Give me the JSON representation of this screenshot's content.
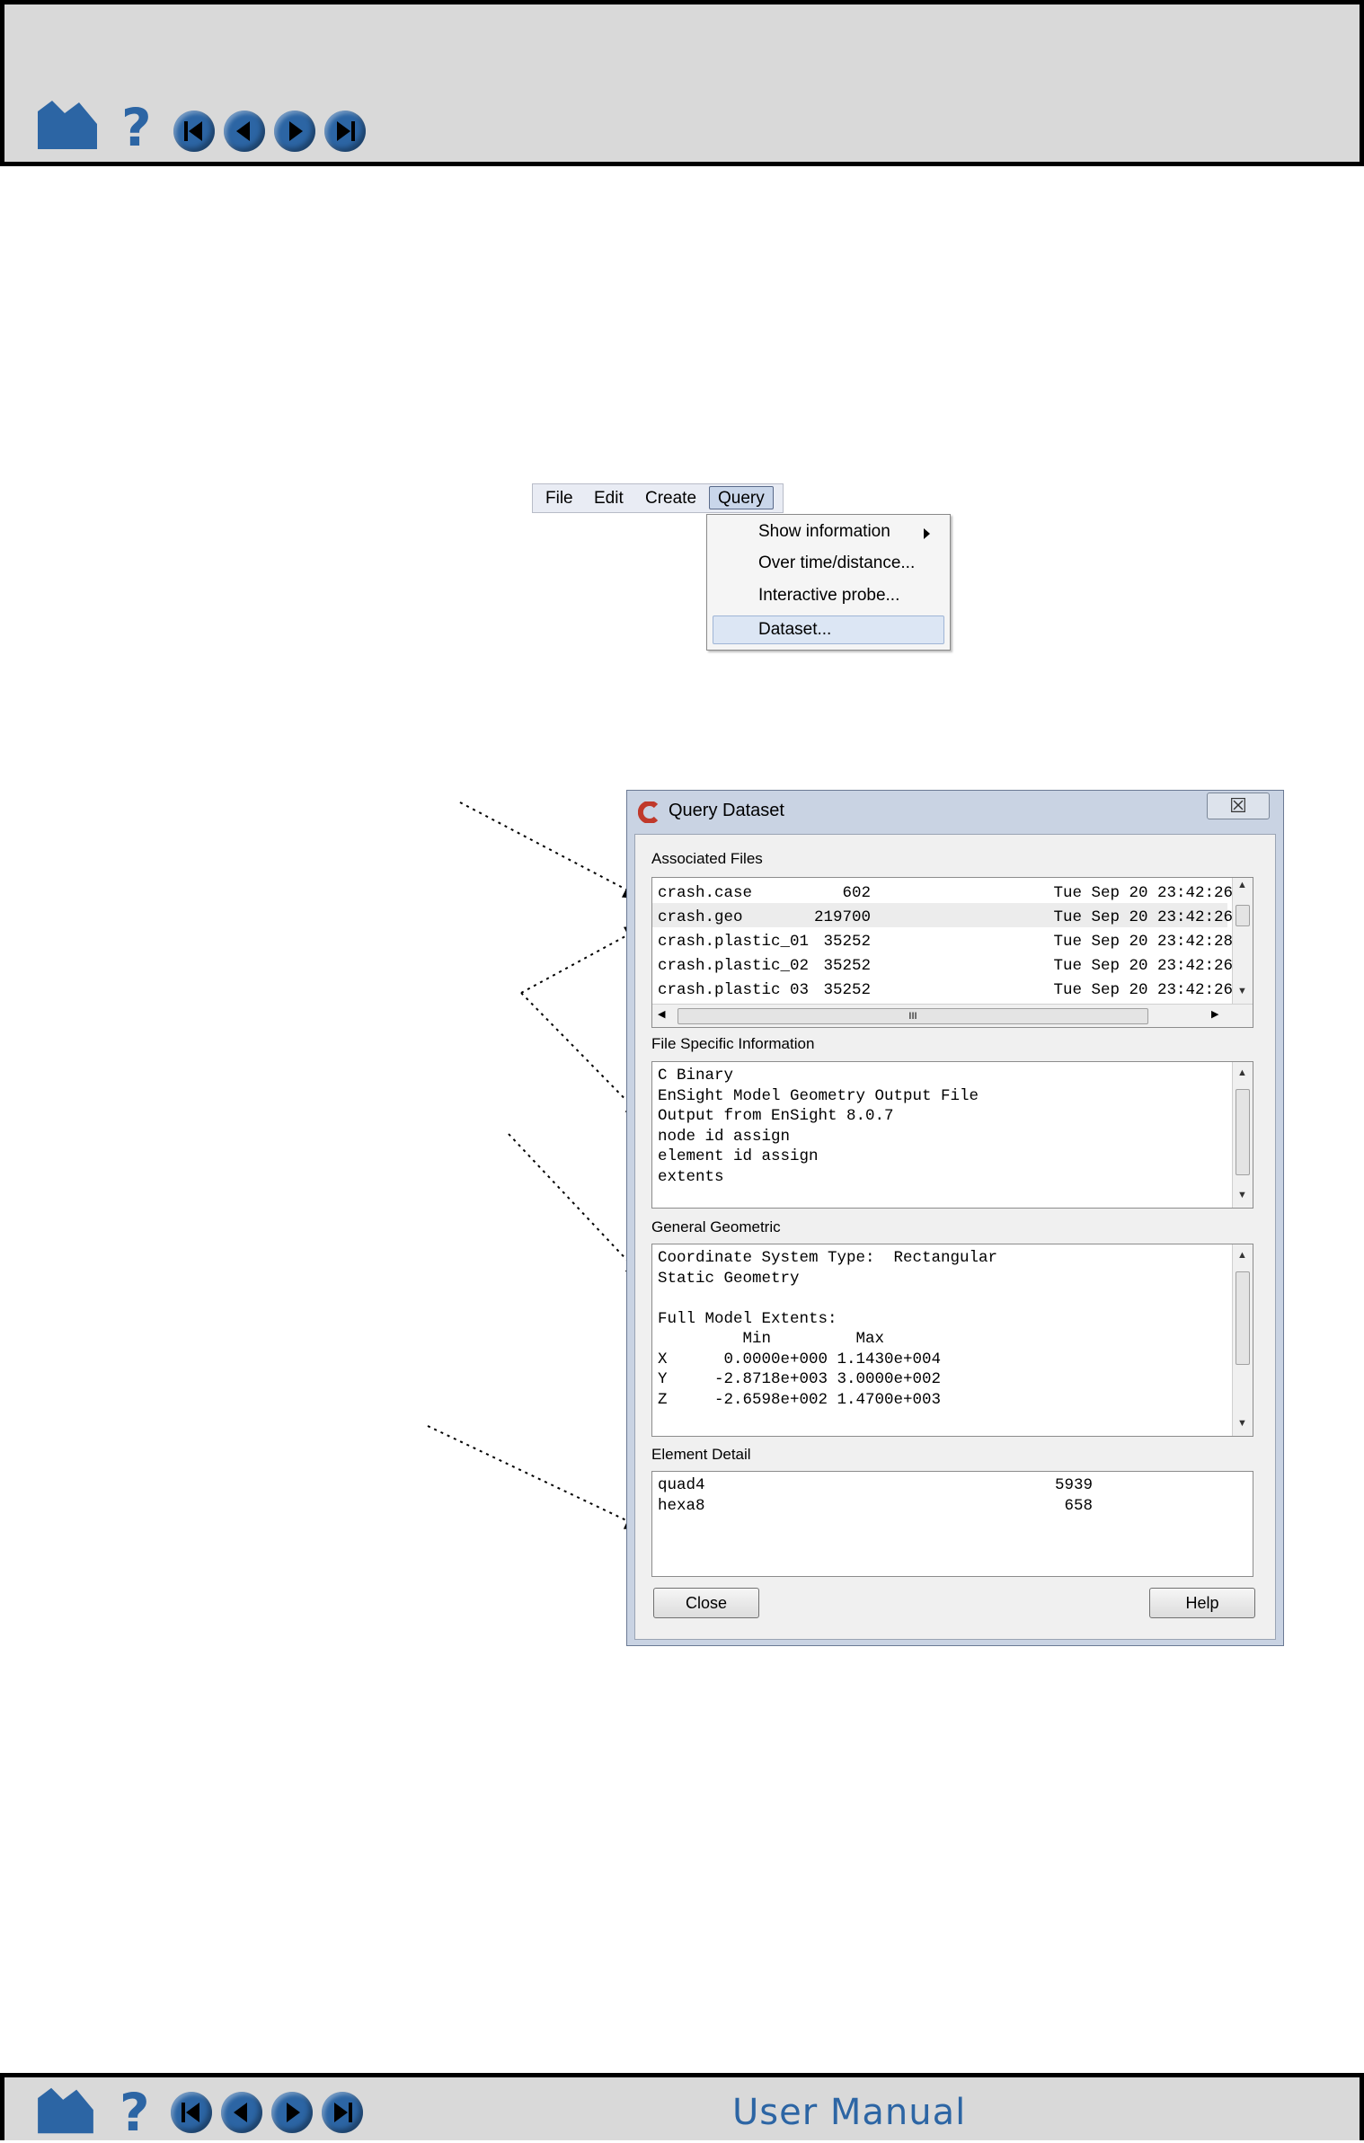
{
  "header": {
    "nav_icons": [
      "home-icon",
      "help-icon",
      "first-page-icon",
      "previous-page-icon",
      "next-page-icon",
      "last-page-icon"
    ]
  },
  "menubar": {
    "items": [
      "File",
      "Edit",
      "Create",
      "Query"
    ]
  },
  "query_menu": {
    "items": [
      "Show information",
      "Over time/distance...",
      "Interactive probe...",
      "Dataset..."
    ]
  },
  "dialog": {
    "title": "Query Dataset",
    "close_glyph": "☒",
    "associated_files": {
      "label": "Associated Files",
      "rows": [
        {
          "name": "crash.case",
          "size": "602",
          "date": "Tue Sep 20 23:42:26"
        },
        {
          "name": "crash.geo",
          "size": "219700",
          "date": "Tue Sep 20 23:42:26"
        },
        {
          "name": "crash.plastic_01",
          "size": "35252",
          "date": "Tue Sep 20 23:42:28"
        },
        {
          "name": "crash.plastic_02",
          "size": "35252",
          "date": "Tue Sep 20 23:42:26"
        },
        {
          "name": "crash.plastic 03",
          "size": "35252",
          "date": "Tue Sep 20 23:42:26"
        }
      ],
      "hscroll_grip": "III"
    },
    "file_specific": {
      "label": "File Specific Information",
      "lines": [
        "C Binary",
        "EnSight Model Geometry Output File",
        "Output from EnSight 8.0.7",
        "node id assign",
        "element id assign",
        "extents"
      ]
    },
    "general_geometric": {
      "label": "General Geometric",
      "lines": [
        "Coordinate System Type:  Rectangular",
        "Static Geometry",
        "",
        "Full Model Extents:",
        "         Min         Max",
        "X      0.0000e+000 1.1430e+004",
        "Y     -2.8718e+003 3.0000e+002",
        "Z     -2.6598e+002 1.4700e+003"
      ]
    },
    "element_detail": {
      "label": "Element Detail",
      "rows": [
        {
          "type": "quad4",
          "count": "5939"
        },
        {
          "type": "hexa8",
          "count": "658"
        }
      ]
    },
    "buttons": {
      "close": "Close",
      "help": "Help"
    }
  },
  "footer": {
    "title": "User Manual"
  },
  "colors": {
    "nav_blue": "#2c65a4",
    "bar_gray": "#d9d9d9",
    "menu_highlight": "#dce6f4"
  }
}
